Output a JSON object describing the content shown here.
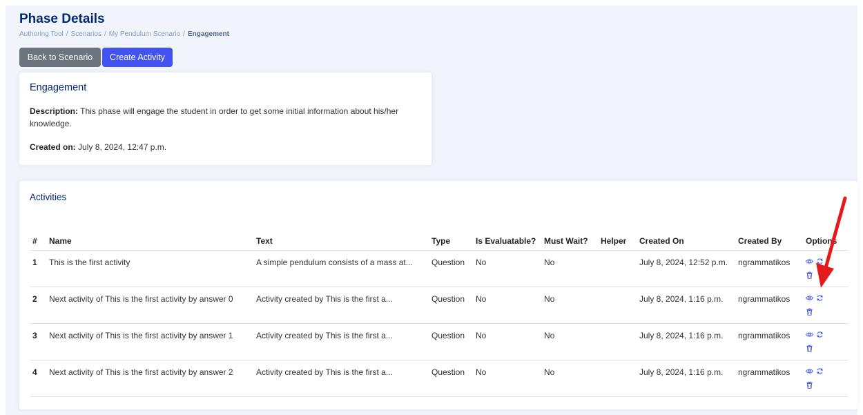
{
  "page_title": "Phase Details",
  "breadcrumb": {
    "items": [
      "Authoring Tool",
      "Scenarios",
      "My Pendulum Scenario"
    ],
    "active": "Engagement",
    "separator": "/"
  },
  "buttons": {
    "back": "Back to Scenario",
    "create": "Create Activity"
  },
  "phase": {
    "title": "Engagement",
    "description_label": "Description:",
    "description": "This phase will engage the student in order to get some initial information about his/her knowledge.",
    "created_label": "Created on:",
    "created": "July 8, 2024, 12:47 p.m."
  },
  "activities": {
    "title": "Activities",
    "columns": [
      "#",
      "Name",
      "Text",
      "Type",
      "Is Evaluatable?",
      "Must Wait?",
      "Helper",
      "Created On",
      "Created By",
      "Options"
    ],
    "rows": [
      {
        "num": "1",
        "name": "This is the first activity",
        "text": "A simple pendulum consists of a mass at...",
        "type": "Question",
        "evaluatable": "No",
        "must_wait": "No",
        "helper": "",
        "created_on": "July 8, 2024, 12:52 p.m.",
        "created_by": "ngrammatikos"
      },
      {
        "num": "2",
        "name": "Next activity of This is the first activity by answer 0",
        "text": "Activity created by This is the first a...",
        "type": "Question",
        "evaluatable": "No",
        "must_wait": "No",
        "helper": "",
        "created_on": "July 8, 2024, 1:16 p.m.",
        "created_by": "ngrammatikos"
      },
      {
        "num": "3",
        "name": "Next activity of This is the first activity by answer 1",
        "text": "Activity created by This is the first a...",
        "type": "Question",
        "evaluatable": "No",
        "must_wait": "No",
        "helper": "",
        "created_on": "July 8, 2024, 1:16 p.m.",
        "created_by": "ngrammatikos"
      },
      {
        "num": "4",
        "name": "Next activity of This is the first activity by answer 2",
        "text": "Activity created by This is the first a...",
        "type": "Question",
        "evaluatable": "No",
        "must_wait": "No",
        "helper": "",
        "created_on": "July 8, 2024, 1:16 p.m.",
        "created_by": "ngrammatikos"
      }
    ],
    "option_icons": [
      "eye-icon",
      "refresh-icon",
      "trash-icon"
    ]
  },
  "colors": {
    "title": "#012970",
    "primary": "#4154f1",
    "secondary": "#6c757d",
    "icon": "#4154f1",
    "annotation_arrow": "#e31b1b",
    "background": "#f1f4fb"
  }
}
